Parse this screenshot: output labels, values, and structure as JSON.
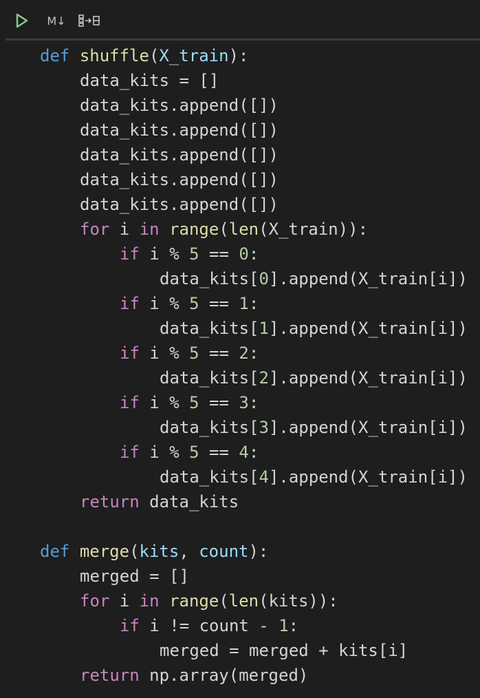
{
  "toolbar": {
    "run_icon": "play-icon",
    "markdown_label": "M↓",
    "variables_icon": "variables-icon",
    "accent": "#89d185"
  },
  "code": {
    "lines": [
      {
        "indent": 1,
        "tokens": [
          {
            "t": "kw",
            "v": "def"
          },
          {
            "t": "pl",
            "v": " "
          },
          {
            "t": "fn",
            "v": "shuffle"
          },
          {
            "t": "pl",
            "v": "("
          },
          {
            "t": "param",
            "v": "X_train"
          },
          {
            "t": "pl",
            "v": "):"
          }
        ]
      },
      {
        "indent": 2,
        "tokens": [
          {
            "t": "pl",
            "v": "data_kits = []"
          }
        ]
      },
      {
        "indent": 2,
        "tokens": [
          {
            "t": "pl",
            "v": "data_kits.append([])"
          }
        ]
      },
      {
        "indent": 2,
        "tokens": [
          {
            "t": "pl",
            "v": "data_kits.append([])"
          }
        ]
      },
      {
        "indent": 2,
        "tokens": [
          {
            "t": "pl",
            "v": "data_kits.append([])"
          }
        ]
      },
      {
        "indent": 2,
        "tokens": [
          {
            "t": "pl",
            "v": "data_kits.append([])"
          }
        ]
      },
      {
        "indent": 2,
        "tokens": [
          {
            "t": "pl",
            "v": "data_kits.append([])"
          }
        ]
      },
      {
        "indent": 2,
        "tokens": [
          {
            "t": "ctrl",
            "v": "for"
          },
          {
            "t": "pl",
            "v": " i "
          },
          {
            "t": "ctrl",
            "v": "in"
          },
          {
            "t": "pl",
            "v": " "
          },
          {
            "t": "fn",
            "v": "range"
          },
          {
            "t": "pl",
            "v": "("
          },
          {
            "t": "fn",
            "v": "len"
          },
          {
            "t": "pl",
            "v": "(X_train)):"
          }
        ]
      },
      {
        "indent": 3,
        "tokens": [
          {
            "t": "ctrl",
            "v": "if"
          },
          {
            "t": "pl",
            "v": " i % "
          },
          {
            "t": "num",
            "v": "5"
          },
          {
            "t": "pl",
            "v": " == "
          },
          {
            "t": "num",
            "v": "0"
          },
          {
            "t": "pl",
            "v": ":"
          }
        ]
      },
      {
        "indent": 4,
        "tokens": [
          {
            "t": "pl",
            "v": "data_kits["
          },
          {
            "t": "num",
            "v": "0"
          },
          {
            "t": "pl",
            "v": "].append(X_train[i])"
          }
        ]
      },
      {
        "indent": 3,
        "tokens": [
          {
            "t": "ctrl",
            "v": "if"
          },
          {
            "t": "pl",
            "v": " i % "
          },
          {
            "t": "num",
            "v": "5"
          },
          {
            "t": "pl",
            "v": " == "
          },
          {
            "t": "num",
            "v": "1"
          },
          {
            "t": "pl",
            "v": ":"
          }
        ]
      },
      {
        "indent": 4,
        "tokens": [
          {
            "t": "pl",
            "v": "data_kits["
          },
          {
            "t": "num",
            "v": "1"
          },
          {
            "t": "pl",
            "v": "].append(X_train[i])"
          }
        ]
      },
      {
        "indent": 3,
        "tokens": [
          {
            "t": "ctrl",
            "v": "if"
          },
          {
            "t": "pl",
            "v": " i % "
          },
          {
            "t": "num",
            "v": "5"
          },
          {
            "t": "pl",
            "v": " == "
          },
          {
            "t": "num",
            "v": "2"
          },
          {
            "t": "pl",
            "v": ":"
          }
        ]
      },
      {
        "indent": 4,
        "tokens": [
          {
            "t": "pl",
            "v": "data_kits["
          },
          {
            "t": "num",
            "v": "2"
          },
          {
            "t": "pl",
            "v": "].append(X_train[i])"
          }
        ]
      },
      {
        "indent": 3,
        "tokens": [
          {
            "t": "ctrl",
            "v": "if"
          },
          {
            "t": "pl",
            "v": " i % "
          },
          {
            "t": "num",
            "v": "5"
          },
          {
            "t": "pl",
            "v": " == "
          },
          {
            "t": "num",
            "v": "3"
          },
          {
            "t": "pl",
            "v": ":"
          }
        ]
      },
      {
        "indent": 4,
        "tokens": [
          {
            "t": "pl",
            "v": "data_kits["
          },
          {
            "t": "num",
            "v": "3"
          },
          {
            "t": "pl",
            "v": "].append(X_train[i])"
          }
        ]
      },
      {
        "indent": 3,
        "tokens": [
          {
            "t": "ctrl",
            "v": "if"
          },
          {
            "t": "pl",
            "v": " i % "
          },
          {
            "t": "num",
            "v": "5"
          },
          {
            "t": "pl",
            "v": " == "
          },
          {
            "t": "num",
            "v": "4"
          },
          {
            "t": "pl",
            "v": ":"
          }
        ]
      },
      {
        "indent": 4,
        "tokens": [
          {
            "t": "pl",
            "v": "data_kits["
          },
          {
            "t": "num",
            "v": "4"
          },
          {
            "t": "pl",
            "v": "].append(X_train[i])"
          }
        ]
      },
      {
        "indent": 2,
        "tokens": [
          {
            "t": "ctrl",
            "v": "return"
          },
          {
            "t": "pl",
            "v": " data_kits"
          }
        ]
      },
      {
        "indent": 0,
        "tokens": []
      },
      {
        "indent": 1,
        "tokens": [
          {
            "t": "kw",
            "v": "def"
          },
          {
            "t": "pl",
            "v": " "
          },
          {
            "t": "fn",
            "v": "merge"
          },
          {
            "t": "pl",
            "v": "("
          },
          {
            "t": "param",
            "v": "kits"
          },
          {
            "t": "pl",
            "v": ", "
          },
          {
            "t": "param",
            "v": "count"
          },
          {
            "t": "pl",
            "v": "):"
          }
        ]
      },
      {
        "indent": 2,
        "tokens": [
          {
            "t": "pl",
            "v": "merged = []"
          }
        ]
      },
      {
        "indent": 2,
        "tokens": [
          {
            "t": "ctrl",
            "v": "for"
          },
          {
            "t": "pl",
            "v": " i "
          },
          {
            "t": "ctrl",
            "v": "in"
          },
          {
            "t": "pl",
            "v": " "
          },
          {
            "t": "fn",
            "v": "range"
          },
          {
            "t": "pl",
            "v": "("
          },
          {
            "t": "fn",
            "v": "len"
          },
          {
            "t": "pl",
            "v": "(kits)):"
          }
        ]
      },
      {
        "indent": 3,
        "tokens": [
          {
            "t": "ctrl",
            "v": "if"
          },
          {
            "t": "pl",
            "v": " i != count - "
          },
          {
            "t": "num",
            "v": "1"
          },
          {
            "t": "pl",
            "v": ":"
          }
        ]
      },
      {
        "indent": 4,
        "tokens": [
          {
            "t": "pl",
            "v": "merged = merged + kits[i]"
          }
        ]
      },
      {
        "indent": 2,
        "tokens": [
          {
            "t": "ctrl",
            "v": "return"
          },
          {
            "t": "pl",
            "v": " np.array(merged)"
          }
        ]
      }
    ]
  }
}
